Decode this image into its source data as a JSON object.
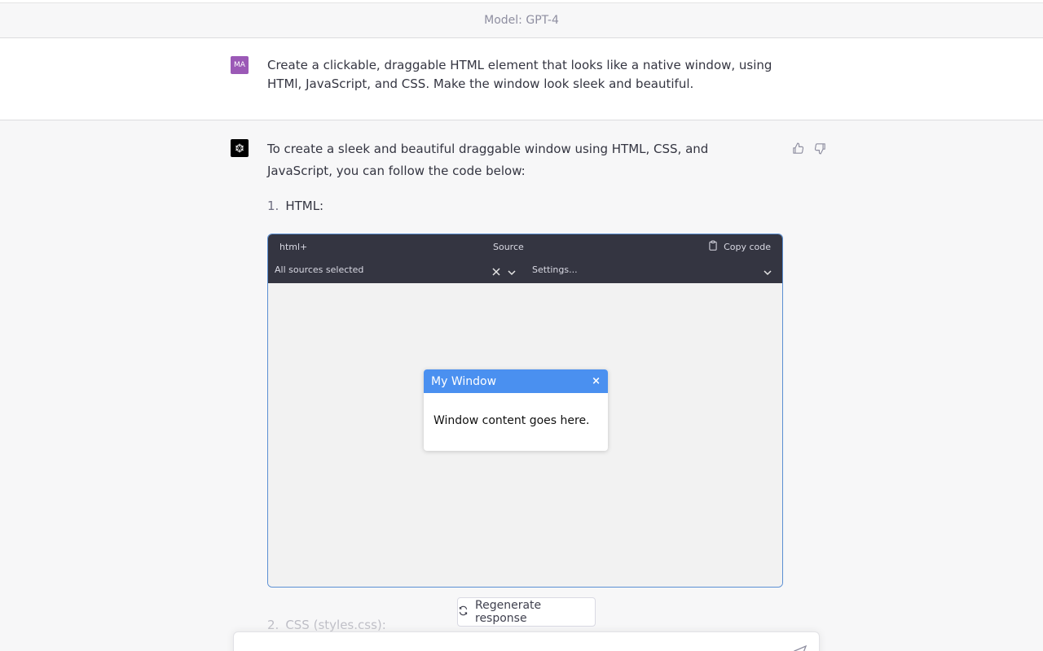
{
  "header": {
    "model_label": "Model: GPT-4"
  },
  "user_message": {
    "avatar_initials": "MA",
    "text": "Create a clickable, draggable HTML element that looks like a native window, using HTMl, JavaScript, and CSS. Make the window look sleek and beautiful."
  },
  "assistant_message": {
    "intro": "To create a sleek and beautiful draggable window using HTML, CSS, and JavaScript, you can follow the code below:",
    "list": [
      {
        "num": "1.",
        "label": "HTML:"
      },
      {
        "num": "2.",
        "label": "CSS (styles.css):"
      }
    ]
  },
  "code_block": {
    "language": "html+",
    "source_label": "Source",
    "copy_label": "Copy code",
    "sources_value": "All sources selected",
    "settings_value": "Settings..."
  },
  "preview_window": {
    "title": "My Window",
    "close_symbol": "×",
    "content": "Window content goes here."
  },
  "regenerate_label": "Regenerate response",
  "colors": {
    "accent_blue": "#4a90f0",
    "avatar_purple": "#9b59b6",
    "code_header_bg": "#343541"
  },
  "icons": [
    "thumbs-up-icon",
    "thumbs-down-icon",
    "clipboard-icon",
    "close-icon",
    "chevron-down-icon",
    "refresh-icon",
    "send-icon",
    "openai-logo-icon"
  ]
}
